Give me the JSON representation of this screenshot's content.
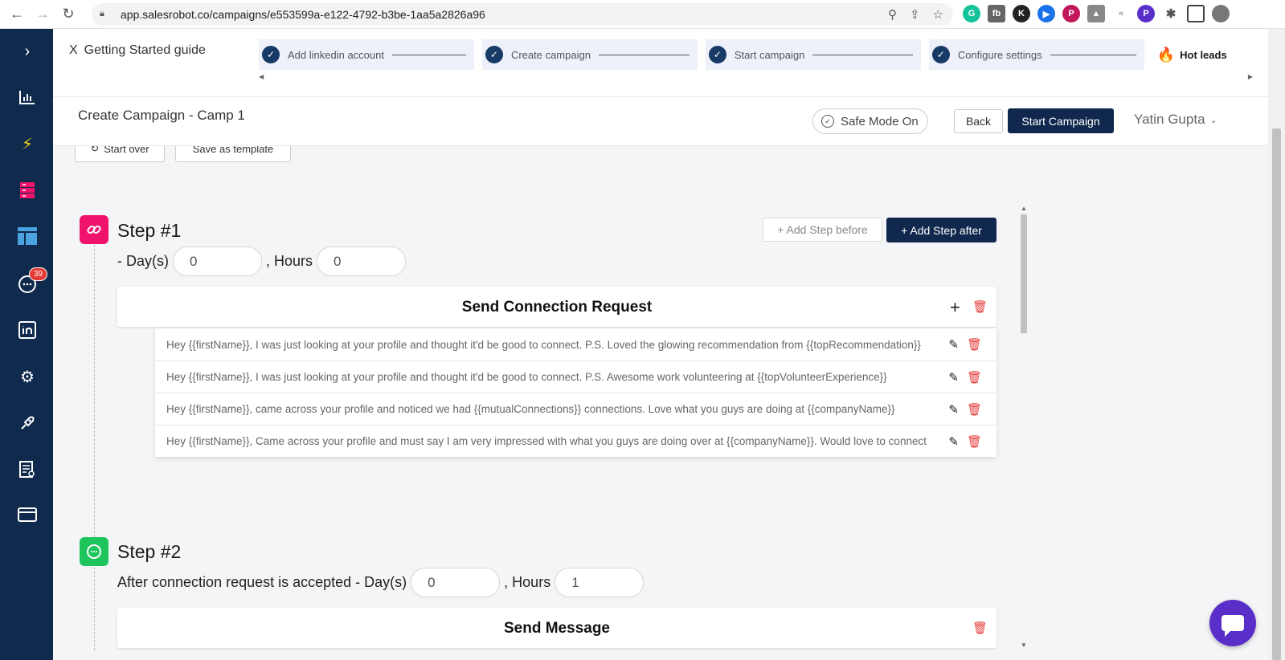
{
  "browser": {
    "url": "app.salesrobot.co/campaigns/e553599a-e122-4792-b3be-1aa5a2826a96"
  },
  "sidebar": {
    "badge_count": "39"
  },
  "guide": {
    "close_label": "X",
    "title": "Getting Started guide",
    "steps": [
      {
        "label": "Add linkedin account"
      },
      {
        "label": "Create campaign"
      },
      {
        "label": "Start campaign"
      },
      {
        "label": "Configure settings"
      }
    ],
    "last_step": "Hot leads"
  },
  "header": {
    "title": "Create Campaign - Camp 1",
    "safe_mode": "Safe Mode On",
    "back": "Back",
    "start_campaign": "Start Campaign",
    "user_name": "Yatin Gupta"
  },
  "toolbar": {
    "start_over": "Start over",
    "save_template": "Save as template"
  },
  "step1": {
    "title": "Step #1",
    "delay_prefix": "- Day(s)",
    "days": "0",
    "hours_label": ", Hours",
    "hours": "0",
    "add_before": "+ Add Step before",
    "add_after": "+ Add Step after",
    "action_title": "Send Connection Request",
    "messages": [
      "Hey {{firstName}}, I was just looking at your profile and thought it'd be good to connect. P.S. Loved the glowing recommendation from {{topRecommendation}}",
      "Hey {{firstName}}, I was just looking at your profile and thought it'd be good to connect. P.S. Awesome work volunteering at {{topVolunteerExperience}}",
      "Hey {{firstName}}, came across your profile and noticed we had {{mutualConnections}} connections. Love what you guys are doing at {{companyName}}",
      "Hey {{firstName}}, Came across your profile and must say I am very impressed with what you guys are doing over at {{companyName}}. Would love to connect"
    ]
  },
  "step2": {
    "title": "Step #2",
    "delay_prefix": "After connection request is accepted - Day(s)",
    "days": "0",
    "hours_label": ", Hours",
    "hours": "1",
    "action_title": "Send Message"
  },
  "colors": {
    "sidebar_bg": "#0f2a4d",
    "primary_button": "#10284d",
    "step1_icon": "#f0136d",
    "step2_icon": "#1fc45c",
    "delete": "#e53935",
    "chat_fab": "#5a2fc9"
  }
}
